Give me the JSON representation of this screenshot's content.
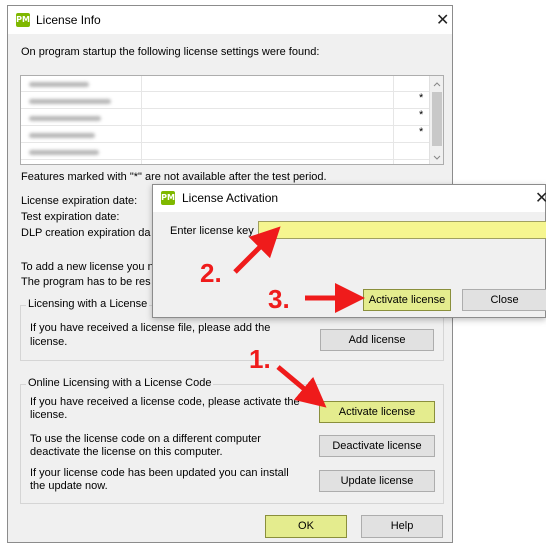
{
  "main_dialog": {
    "icon_text": "PM",
    "title": "License Info",
    "close": "✕",
    "startup_text": "On program startup the following license settings were found:",
    "marker": "*",
    "features_note": "Features marked with \"*\" are not available after the test period.",
    "expiration_labels": [
      "License expiration date:",
      "Test expiration date:",
      "DLP creation expiration da"
    ],
    "add_license_note_1": "To add a new license you n",
    "add_license_note_2": "The program has to be res",
    "group_file": {
      "title": "Licensing with a License",
      "text_1": "If you have received a license file, please add the",
      "text_2": "license.",
      "button": "Add license"
    },
    "group_code": {
      "title": "Online Licensing with a License Code",
      "activate_text_1": "If you have received a license code, please activate  the",
      "activate_text_2": "license.",
      "activate_button": "Activate license",
      "deactivate_text_1": "To use the license code on a different computer",
      "deactivate_text_2": "deactivate the license on this computer.",
      "deactivate_button": "Deactivate license",
      "update_text_1": "If your license code has been updated you can install",
      "update_text_2": "the update now.",
      "update_button": "Update license"
    },
    "ok_button": "OK",
    "help_button": "Help"
  },
  "activation_dialog": {
    "icon_text": "PM",
    "title": "License Activation",
    "close": "✕",
    "key_label": "Enter license key",
    "key_value": "",
    "activate_button": "Activate license",
    "close_button": "Close"
  },
  "annotations": {
    "step1": "1.",
    "step2": "2.",
    "step3": "3."
  },
  "colors": {
    "highlight_button": "#e4ec8e",
    "input_yellow": "#f5f58f",
    "annotation_red": "#ef1b1b",
    "app_icon_green": "#7fb800"
  }
}
